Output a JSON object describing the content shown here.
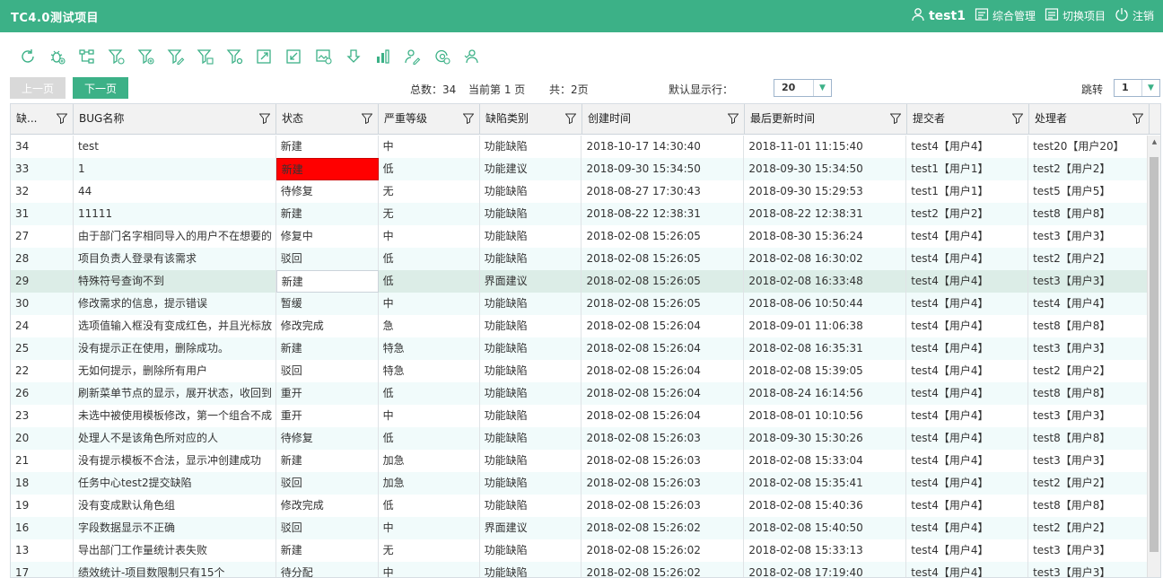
{
  "app": {
    "title": "TC4.0测试项目"
  },
  "topnav": {
    "user": "test1",
    "manage": "综合管理",
    "switch_project": "切换项目",
    "logout": "注销"
  },
  "toolbar": {
    "icons": [
      "refresh-icon",
      "bug-add-icon",
      "tree-icon",
      "filter-icon",
      "filter-add-icon",
      "filter-edit-icon",
      "filter-delete-icon",
      "filter-settings-icon",
      "export-icon",
      "import-icon",
      "image-export-icon",
      "download-icon",
      "chart-icon",
      "assign-users-icon",
      "reassign-icon",
      "batch-users-icon"
    ]
  },
  "pager": {
    "prev": "上一页",
    "next": "下一页",
    "total": "总数：34",
    "current": "当前第 1 页",
    "pages": "共：2页",
    "rows_label": "默认显示行：",
    "rows_value": "20",
    "jump_label": "跳转",
    "jump_value": "1"
  },
  "columns": [
    "缺...",
    "BUG名称",
    "状态",
    "严重等级",
    "缺陷类别",
    "创建时间",
    "最后更新时间",
    "提交者",
    "处理者"
  ],
  "rows": [
    [
      "34",
      "test",
      "新建",
      "中",
      "功能缺陷",
      "2018-10-17 14:30:40",
      "2018-11-01 11:15:40",
      "test4【用户4】",
      "test20【用户20】"
    ],
    [
      "33",
      "1",
      "新建",
      "低",
      "功能建议",
      "2018-09-30 15:34:50",
      "2018-09-30 15:34:50",
      "test1【用户1】",
      "test2【用户2】"
    ],
    [
      "32",
      "44",
      "待修复",
      "无",
      "功能缺陷",
      "2018-08-27 17:30:43",
      "2018-09-30 15:29:53",
      "test1【用户1】",
      "test5【用户5】"
    ],
    [
      "31",
      "11111",
      "新建",
      "无",
      "功能缺陷",
      "2018-08-22 12:38:31",
      "2018-08-22 12:38:31",
      "test2【用户2】",
      "test8【用户8】"
    ],
    [
      "27",
      "由于部门名字相同导入的用户不在想要的",
      "修复中",
      "中",
      "功能缺陷",
      "2018-02-08 15:26:05",
      "2018-08-30 15:36:24",
      "test4【用户4】",
      "test3【用户3】"
    ],
    [
      "28",
      "项目负责人登录有该需求",
      "驳回",
      "低",
      "功能缺陷",
      "2018-02-08 15:26:05",
      "2018-02-08 16:30:02",
      "test4【用户4】",
      "test2【用户2】"
    ],
    [
      "29",
      "特殊符号查询不到",
      "新建",
      "低",
      "界面建议",
      "2018-02-08 15:26:05",
      "2018-02-08 16:33:48",
      "test4【用户4】",
      "test3【用户3】"
    ],
    [
      "30",
      "修改需求的信息，提示错误",
      "暂缓",
      "中",
      "功能缺陷",
      "2018-02-08 15:26:05",
      "2018-08-06 10:50:44",
      "test4【用户4】",
      "test4【用户4】"
    ],
    [
      "24",
      "选项值输入框没有变成红色，并且光标放",
      "修改完成",
      "急",
      "功能缺陷",
      "2018-02-08 15:26:04",
      "2018-09-01 11:06:38",
      "test4【用户4】",
      "test8【用户8】"
    ],
    [
      "25",
      "没有提示正在使用，删除成功。",
      "新建",
      "特急",
      "功能缺陷",
      "2018-02-08 15:26:04",
      "2018-02-08 16:35:31",
      "test4【用户4】",
      "test3【用户3】"
    ],
    [
      "22",
      "无如何提示，删除所有用户",
      "驳回",
      "特急",
      "功能缺陷",
      "2018-02-08 15:26:04",
      "2018-02-08 15:39:05",
      "test4【用户4】",
      "test2【用户2】"
    ],
    [
      "26",
      "刷新菜单节点的显示，展开状态，收回到",
      "重开",
      "低",
      "功能缺陷",
      "2018-02-08 15:26:04",
      "2018-08-24 16:14:56",
      "test4【用户4】",
      "test8【用户8】"
    ],
    [
      "23",
      "未选中被使用模板修改，第一个组合不成",
      "重开",
      "中",
      "功能缺陷",
      "2018-02-08 15:26:04",
      "2018-08-01 10:10:56",
      "test4【用户4】",
      "test3【用户3】"
    ],
    [
      "20",
      "处理人不是该角色所对应的人",
      "待修复",
      "低",
      "功能缺陷",
      "2018-02-08 15:26:03",
      "2018-09-30 15:30:26",
      "test4【用户4】",
      "test8【用户8】"
    ],
    [
      "21",
      "没有提示模板不合法，显示冲创建成功",
      "新建",
      "加急",
      "功能缺陷",
      "2018-02-08 15:26:03",
      "2018-02-08 15:33:04",
      "test4【用户4】",
      "test3【用户3】"
    ],
    [
      "18",
      "任务中心test2提交缺陷",
      "驳回",
      "加急",
      "功能缺陷",
      "2018-02-08 15:26:03",
      "2018-02-08 15:35:41",
      "test4【用户4】",
      "test2【用户2】"
    ],
    [
      "19",
      "没有变成默认角色组",
      "修改完成",
      "低",
      "功能缺陷",
      "2018-02-08 15:26:03",
      "2018-02-08 15:40:36",
      "test4【用户4】",
      "test8【用户8】"
    ],
    [
      "16",
      "字段数据显示不正确",
      "驳回",
      "中",
      "界面建议",
      "2018-02-08 15:26:02",
      "2018-02-08 15:40:50",
      "test4【用户4】",
      "test2【用户2】"
    ],
    [
      "13",
      "导出部门工作量统计表失败",
      "新建",
      "无",
      "功能缺陷",
      "2018-02-08 15:26:02",
      "2018-02-08 15:33:13",
      "test4【用户4】",
      "test3【用户3】"
    ],
    [
      "17",
      "绩效统计-项目数限制只有15个",
      "待分配",
      "中",
      "功能缺陷",
      "2018-02-08 15:26:02",
      "2018-02-08 17:19:40",
      "test4【用户4】",
      "test3【用户3】"
    ]
  ],
  "colors": {
    "brand": "#3cb187",
    "status_highlight": "#ff0000",
    "row_alt": "#f1fbfb",
    "row_selected": "#dcede7"
  }
}
